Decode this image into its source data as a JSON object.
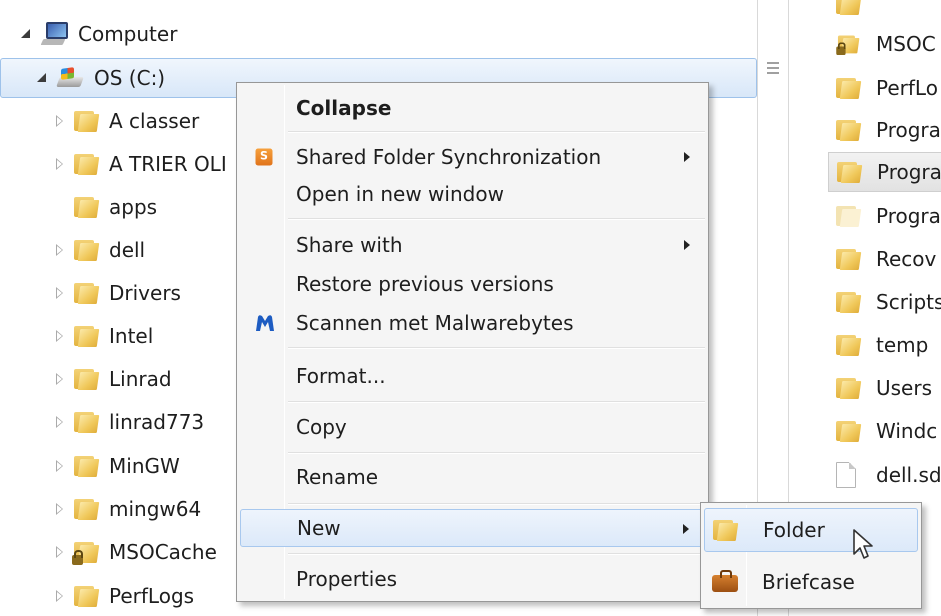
{
  "nav_tree": {
    "computer_label": "Computer",
    "drive_label": "OS (C:)",
    "folders": [
      {
        "label": "A classer",
        "expandable": true
      },
      {
        "label": "A TRIER OLI",
        "expandable": true
      },
      {
        "label": "apps",
        "expandable": false
      },
      {
        "label": "dell",
        "expandable": true
      },
      {
        "label": "Drivers",
        "expandable": true
      },
      {
        "label": "Intel",
        "expandable": true
      },
      {
        "label": "Linrad",
        "expandable": true
      },
      {
        "label": "linrad773",
        "expandable": true
      },
      {
        "label": "MinGW",
        "expandable": true
      },
      {
        "label": "mingw64",
        "expandable": true
      },
      {
        "label": "MSOCache",
        "expandable": true,
        "locked": true
      },
      {
        "label": "PerfLogs",
        "expandable": true
      }
    ]
  },
  "content_pane": {
    "items": [
      {
        "label": "MSOC",
        "icon": "locked-folder-icon"
      },
      {
        "label": "PerfLo",
        "icon": "folder-icon"
      },
      {
        "label": "Progra",
        "icon": "folder-icon"
      },
      {
        "label": "Progra",
        "icon": "folder-icon",
        "highlighted": true
      },
      {
        "label": "Progra",
        "icon": "folder-icon",
        "faded": true
      },
      {
        "label": "Recov",
        "icon": "folder-icon"
      },
      {
        "label": "Scripts",
        "icon": "folder-icon"
      },
      {
        "label": "temp",
        "icon": "folder-icon"
      },
      {
        "label": "Users",
        "icon": "folder-icon"
      },
      {
        "label": "Windc",
        "icon": "folder-icon"
      },
      {
        "label": "dell.sd",
        "icon": "file-icon"
      }
    ]
  },
  "context_menu": {
    "collapse": "Collapse",
    "shared_folder_sync": "Shared Folder Synchronization",
    "open_new_window": "Open in new window",
    "share_with": "Share with",
    "restore_previous": "Restore previous versions",
    "scan_malwarebytes": "Scannen met Malwarebytes",
    "format": "Format...",
    "copy": "Copy",
    "rename": "Rename",
    "new": "New",
    "properties": "Properties"
  },
  "new_submenu": {
    "folder": "Folder",
    "briefcase": "Briefcase"
  },
  "colors": {
    "selection_fill": "#dce9f9",
    "selection_border": "#a8c8ee",
    "menu_background": "#f5f5f5",
    "malwarebytes_blue": "#1d5cc2",
    "sync_orange": "#e0731a"
  }
}
